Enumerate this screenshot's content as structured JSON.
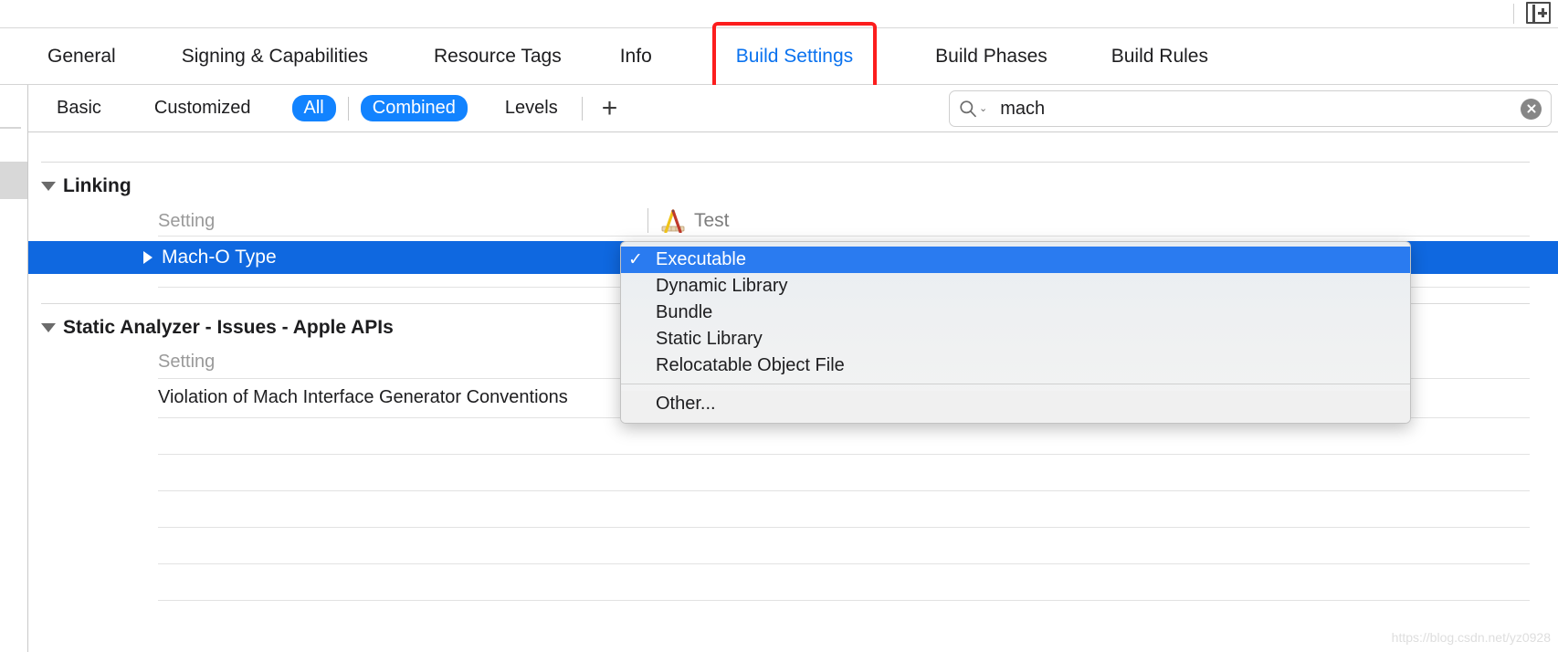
{
  "window": {
    "split_editor_icon": "split-editor-icon"
  },
  "tabs": [
    {
      "label": "General",
      "selected": false
    },
    {
      "label": "Signing & Capabilities",
      "selected": false
    },
    {
      "label": "Resource Tags",
      "selected": false
    },
    {
      "label": "Info",
      "selected": false
    },
    {
      "label": "Build Settings",
      "selected": true
    },
    {
      "label": "Build Phases",
      "selected": false
    },
    {
      "label": "Build Rules",
      "selected": false
    }
  ],
  "filter_bar": {
    "scope": [
      {
        "label": "Basic",
        "active": false
      },
      {
        "label": "Customized",
        "active": false
      },
      {
        "label": "All",
        "active": true
      }
    ],
    "mode": [
      {
        "label": "Combined",
        "active": true
      },
      {
        "label": "Levels",
        "active": false
      }
    ],
    "add_label": "+"
  },
  "search": {
    "value": "mach",
    "placeholder": "",
    "icon": "search-icon",
    "chevron": "⌄",
    "clear_icon": "clear-icon"
  },
  "table": {
    "column_setting_label": "Setting",
    "target": {
      "name": "Test",
      "icon": "xcode-project-icon"
    },
    "groups": [
      {
        "title": "Linking",
        "expanded": true,
        "rows": [
          {
            "name": "Mach-O Type",
            "selected": true,
            "expandable": true,
            "value": "Executable"
          }
        ]
      },
      {
        "title": "Static Analyzer - Issues - Apple APIs",
        "expanded": true,
        "rows": [
          {
            "name": "Violation of Mach Interface Generator Conventions",
            "selected": false,
            "expandable": false,
            "value": ""
          }
        ]
      }
    ]
  },
  "dropdown": {
    "items": [
      {
        "label": "Executable",
        "checked": true,
        "selected": true
      },
      {
        "label": "Dynamic Library",
        "checked": false,
        "selected": false
      },
      {
        "label": "Bundle",
        "checked": false,
        "selected": false
      },
      {
        "label": "Static Library",
        "checked": false,
        "selected": false
      },
      {
        "label": "Relocatable Object File",
        "checked": false,
        "selected": false
      }
    ],
    "footer": {
      "label": "Other...",
      "checked": false,
      "selected": false
    },
    "checkmark": "✓"
  },
  "watermark": "https://blog.csdn.net/yz0928",
  "colors": {
    "accent_blue": "#0a72ef",
    "pill_blue": "#1283ff",
    "row_selected_blue": "#0f68e0",
    "menu_selected_blue": "#2a7bf0",
    "highlight_red": "#fc1d1d"
  }
}
